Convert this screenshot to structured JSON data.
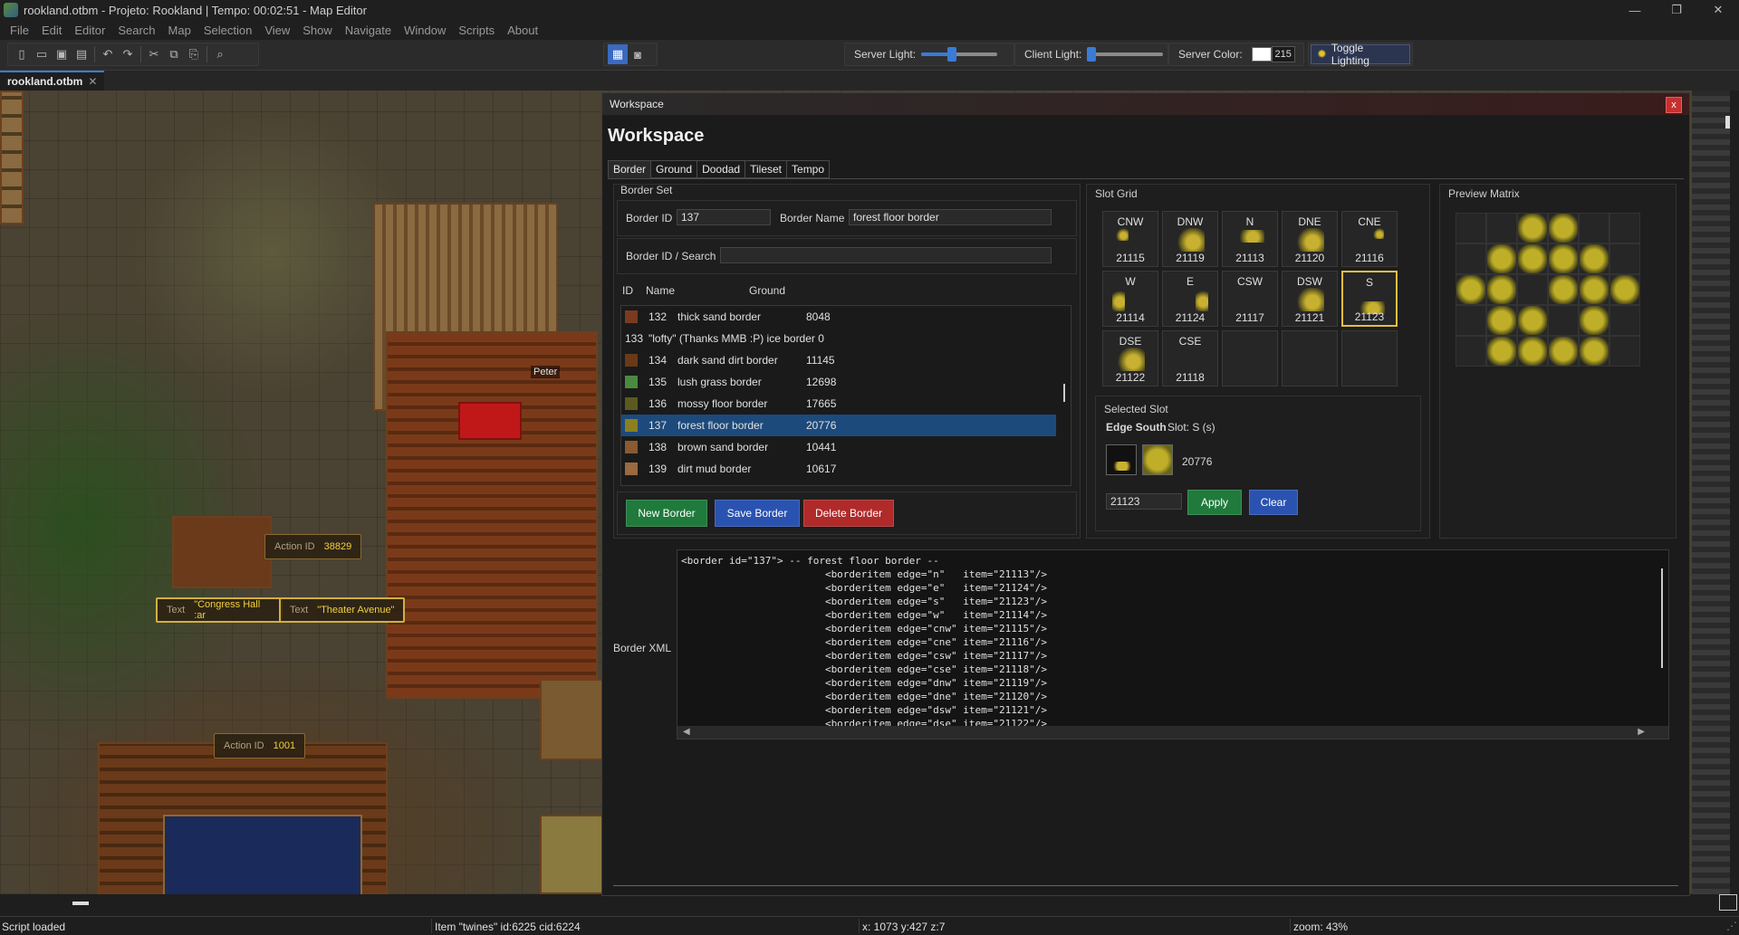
{
  "window": {
    "title": "rookland.otbm - Projeto: Rookland | Tempo: 00:02:51 - Map Editor"
  },
  "menu": [
    "File",
    "Edit",
    "Editor",
    "Search",
    "Map",
    "Selection",
    "View",
    "Show",
    "Navigate",
    "Window",
    "Scripts",
    "About"
  ],
  "toolbar": {
    "server_light_label": "Server Light:",
    "server_light_level": 0.4,
    "client_light_label": "Client Light:",
    "client_light_level": 0.05,
    "server_color_label": "Server Color:",
    "server_color_value": "215",
    "server_color_swatch": "#ffffff",
    "toggle_lighting_label": "Toggle Lighting"
  },
  "doc_tab": {
    "label": "rookland.otbm",
    "close": "✕"
  },
  "map": {
    "npc_name": "Peter",
    "tags": [
      {
        "key": "Action ID",
        "value": "38829"
      },
      {
        "key": "Text",
        "value": "\"Congress Hall :ar"
      },
      {
        "key": "Text",
        "value": "\"Theater Avenue\""
      },
      {
        "key": "Action ID",
        "value": "1001"
      }
    ]
  },
  "workspace": {
    "header": "Workspace",
    "close": "x",
    "title": "Workspace",
    "tabs": [
      "Border",
      "Ground",
      "Doodad",
      "Tileset",
      "Tempo"
    ],
    "active_tab": "Border",
    "border_set": {
      "title": "Border Set",
      "border_id_label": "Border ID",
      "border_id_value": "137",
      "border_name_label": "Border Name",
      "border_name_value": "forest floor border",
      "search_label": "Border ID / Search",
      "search_value": "",
      "columns": {
        "id": "ID",
        "name": "Name",
        "ground": "Ground"
      },
      "rows": [
        {
          "id": "132",
          "name": "thick sand border",
          "ground": "8048",
          "color": "#7a3a20"
        },
        {
          "id": "133",
          "name": "\"lofty\" (Thanks MMB :P) ice border 0",
          "ground": "",
          "color": ""
        },
        {
          "id": "134",
          "name": "dark sand dirt border",
          "ground": "11145",
          "color": "#6a3a18"
        },
        {
          "id": "135",
          "name": "lush grass border",
          "ground": "12698",
          "color": "#4a8a40"
        },
        {
          "id": "136",
          "name": "mossy floor border",
          "ground": "17665",
          "color": "#5a5a20"
        },
        {
          "id": "137",
          "name": "forest floor border",
          "ground": "20776",
          "color": "#8a8020"
        },
        {
          "id": "138",
          "name": "brown sand border",
          "ground": "10441",
          "color": "#8a5a30"
        },
        {
          "id": "139",
          "name": "dirt mud border",
          "ground": "10617",
          "color": "#9a6a40"
        }
      ],
      "selected_id": "137",
      "new_label": "New Border",
      "save_label": "Save Border",
      "delete_label": "Delete Border"
    },
    "slot_grid": {
      "title": "Slot Grid",
      "slots": [
        {
          "name": "CNW",
          "item": "21115"
        },
        {
          "name": "DNW",
          "item": "21119"
        },
        {
          "name": "N",
          "item": "21113"
        },
        {
          "name": "DNE",
          "item": "21120"
        },
        {
          "name": "CNE",
          "item": "21116"
        },
        {
          "name": "W",
          "item": "21114"
        },
        {
          "name": "E",
          "item": "21124"
        },
        {
          "name": "CSW",
          "item": "21117"
        },
        {
          "name": "DSW",
          "item": "21121"
        },
        {
          "name": "S",
          "item": "21123"
        },
        {
          "name": "DSE",
          "item": "21122"
        },
        {
          "name": "CSE",
          "item": "21118"
        },
        {
          "name": "",
          "item": ""
        },
        {
          "name": "",
          "item": ""
        },
        {
          "name": "",
          "item": ""
        }
      ],
      "selected_slot": "S"
    },
    "selected_slot": {
      "title": "Selected Slot",
      "edge_label": "Edge South",
      "slot_text": "Slot: S (s)",
      "ground_item": "20776",
      "item_value": "21123",
      "apply_label": "Apply",
      "clear_label": "Clear"
    },
    "preview": {
      "title": "Preview Matrix"
    },
    "xml": {
      "label": "Border XML",
      "text": "<border id=\"137\"> -- forest floor border --\n                        <borderitem edge=\"n\"   item=\"21113\"/>\n                        <borderitem edge=\"e\"   item=\"21124\"/>\n                        <borderitem edge=\"s\"   item=\"21123\"/>\n                        <borderitem edge=\"w\"   item=\"21114\"/>\n                        <borderitem edge=\"cnw\" item=\"21115\"/>\n                        <borderitem edge=\"cne\" item=\"21116\"/>\n                        <borderitem edge=\"csw\" item=\"21117\"/>\n                        <borderitem edge=\"cse\" item=\"21118\"/>\n                        <borderitem edge=\"dnw\" item=\"21119\"/>\n                        <borderitem edge=\"dne\" item=\"21120\"/>\n                        <borderitem edge=\"dsw\" item=\"21121\"/>\n                        <borderitem edge=\"dse\" item=\"21122\"/>"
    }
  },
  "status": {
    "message": "Script loaded",
    "item": "Item \"twines\" id:6225 cid:6224",
    "coords": "x: 1073 y:427 z:7",
    "zoom": "zoom: 43%"
  }
}
